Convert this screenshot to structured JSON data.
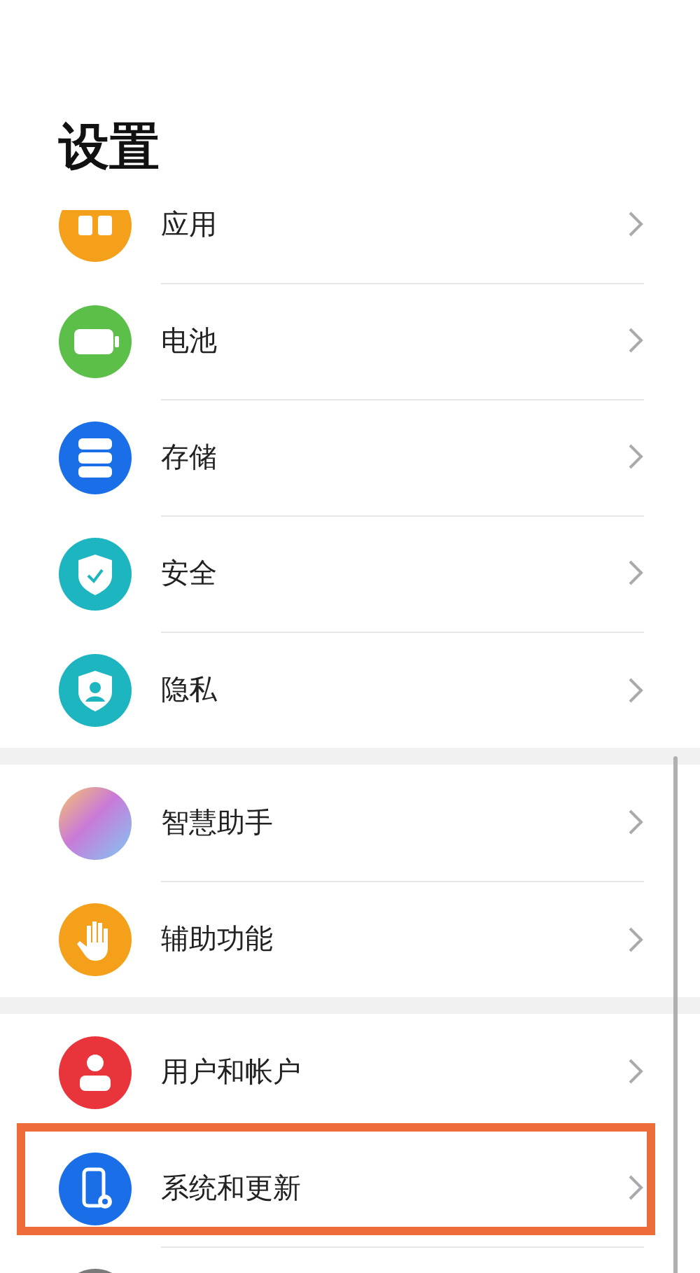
{
  "title": "设置",
  "groups": [
    {
      "items": [
        {
          "kind": "row",
          "label": "应用",
          "highlighted": false
        },
        {
          "kind": "row",
          "label": "电池",
          "highlighted": false
        },
        {
          "kind": "row",
          "label": "存储",
          "highlighted": false
        },
        {
          "kind": "row",
          "label": "安全",
          "highlighted": false
        },
        {
          "kind": "row",
          "label": "隐私",
          "highlighted": false
        }
      ]
    },
    {
      "items": [
        {
          "kind": "row",
          "label": "智慧助手",
          "highlighted": false
        },
        {
          "kind": "row",
          "label": "辅助功能",
          "highlighted": false
        }
      ]
    },
    {
      "items": [
        {
          "kind": "row",
          "label": "用户和帐户",
          "highlighted": false
        },
        {
          "kind": "row",
          "label": "系统和更新",
          "highlighted": true
        },
        {
          "kind": "clipped"
        }
      ]
    }
  ]
}
